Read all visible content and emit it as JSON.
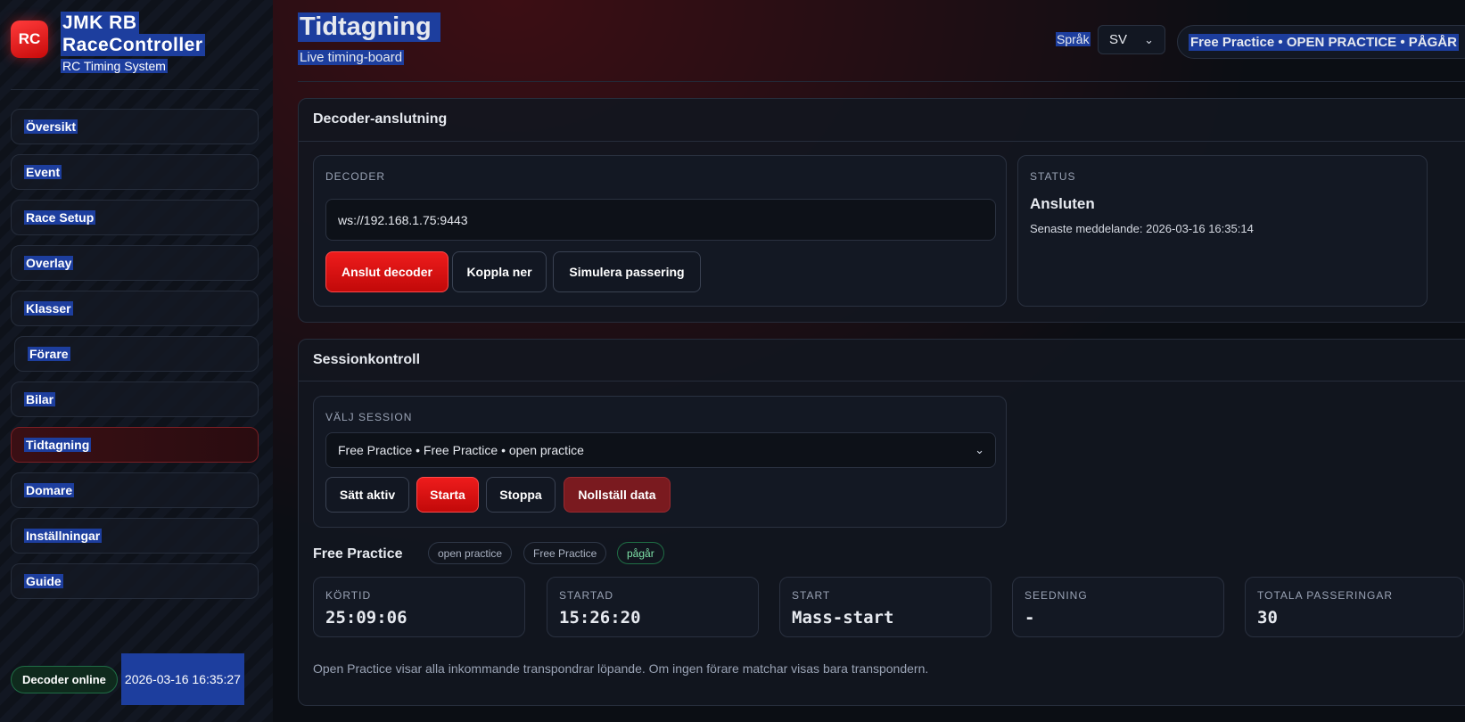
{
  "brand": {
    "logo_text": "RC",
    "title_line1": "JMK RB",
    "title_line2": "RaceController",
    "subtitle": "RC Timing System"
  },
  "sidebar": {
    "items": [
      {
        "label": "Översikt"
      },
      {
        "label": "Event"
      },
      {
        "label": "Race Setup"
      },
      {
        "label": "Overlay"
      },
      {
        "label": "Klasser"
      },
      {
        "label": "Förare"
      },
      {
        "label": "Bilar"
      },
      {
        "label": "Tidtagning"
      },
      {
        "label": "Domare"
      },
      {
        "label": "Inställningar"
      },
      {
        "label": "Guide"
      }
    ],
    "active": "Tidtagning",
    "footer": {
      "decoder_status": "Decoder online",
      "time": "2026-03-16 16:35:27"
    }
  },
  "header": {
    "title": "Tidtagning",
    "subtitle": "Live timing-board",
    "language_label": "Språk",
    "language_value": "SV",
    "session_pill": "Free Practice • OPEN PRACTICE • PÅGÅR"
  },
  "decoder_panel": {
    "title": "Decoder-anslutning",
    "decoder_label": "DECODER",
    "url": "ws://192.168.1.75:9443",
    "buttons": {
      "connect": "Anslut decoder",
      "disconnect": "Koppla ner",
      "simulate": "Simulera passering"
    },
    "status_label": "STATUS",
    "status_value": "Ansluten",
    "last_message": "Senaste meddelande: 2026-03-16 16:35:14"
  },
  "session_panel": {
    "title": "Sessionkontroll",
    "select_label": "VÄLJ SESSION",
    "selected_session": "Free Practice • Free Practice • open practice",
    "buttons": {
      "set_active": "Sätt aktiv",
      "start": "Starta",
      "stop": "Stoppa",
      "reset": "Nollställ data"
    },
    "current": {
      "name": "Free Practice",
      "badges": [
        "open practice",
        "Free Practice",
        "pågår"
      ]
    },
    "stats": [
      {
        "label": "KÖRTID",
        "value": "25:09:06"
      },
      {
        "label": "STARTAD",
        "value": "15:26:20"
      },
      {
        "label": "START",
        "value": "Mass-start"
      },
      {
        "label": "SEEDNING",
        "value": "-"
      },
      {
        "label": "TOTALA PASSERINGAR",
        "value": "30"
      }
    ],
    "note": "Open Practice visar alla inkommande transpondrar löpande. Om ingen förare matchar visas bara transpondern."
  },
  "colors": {
    "accent_red": "#e01414",
    "success_green": "#1f6e45",
    "selection_blue": "#1d3e9e"
  }
}
